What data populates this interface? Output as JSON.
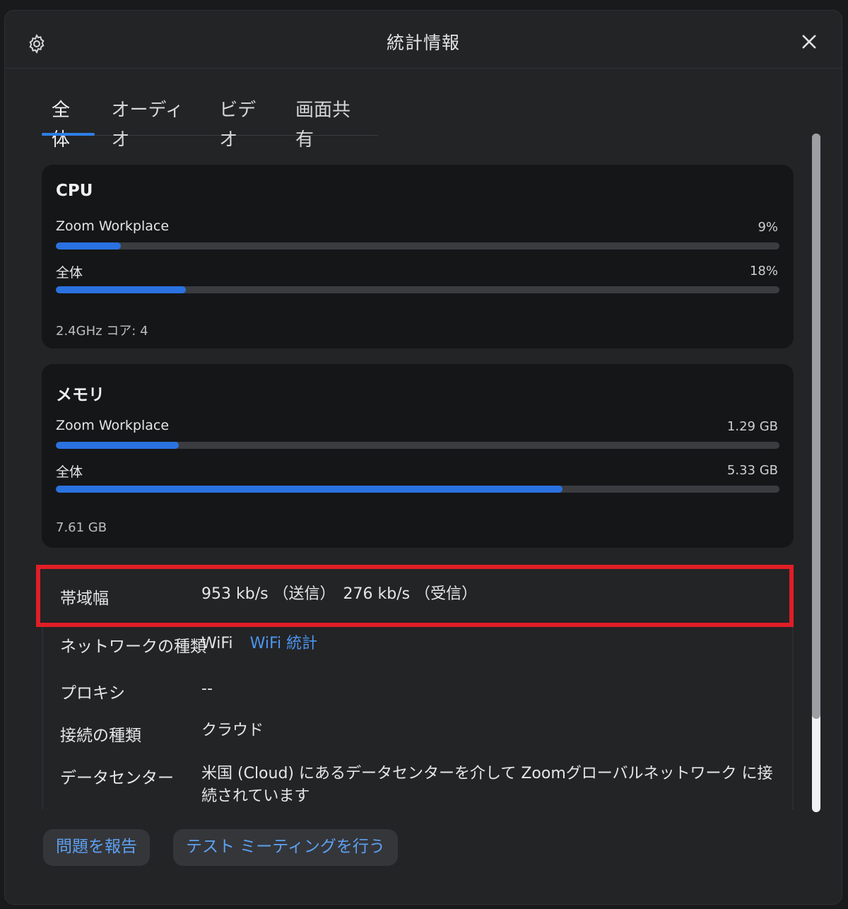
{
  "window": {
    "title": "統計情報"
  },
  "icons": {
    "settings": "gear-icon",
    "close": "close-icon"
  },
  "tabs": [
    {
      "label": "全体",
      "active": true
    },
    {
      "label": "オーディオ",
      "active": false
    },
    {
      "label": "ビデオ",
      "active": false
    },
    {
      "label": "画面共有",
      "active": false
    }
  ],
  "cpu": {
    "title": "CPU",
    "rows": [
      {
        "label": "Zoom Workplace",
        "value": "9%",
        "fraction": 0.09
      },
      {
        "label": "全体",
        "value": "18%",
        "fraction": 0.18
      }
    ],
    "footer": "2.4GHz コア: 4"
  },
  "memory": {
    "title": "メモリ",
    "rows": [
      {
        "label": "Zoom Workplace",
        "value": "1.29 GB",
        "fraction": 0.17
      },
      {
        "label": "全体",
        "value": "5.33 GB",
        "fraction": 0.7
      }
    ],
    "footer": "7.61 GB"
  },
  "info": {
    "bandwidth": {
      "label": "帯域幅",
      "value": "953 kb/s （送信）　276 kb/s （受信）"
    },
    "network": {
      "label": "ネットワークの種類",
      "value": "WiFi",
      "link": "WiFi 統計"
    },
    "proxy": {
      "label": "プロキシ",
      "value": "--"
    },
    "connection": {
      "label": "接続の種類",
      "value": "クラウド"
    },
    "datacenter": {
      "label": "データセンター",
      "value": "米国 (Cloud) にあるデータセンターを介して Zoomグローバルネットワーク に接続されています"
    }
  },
  "buttons": {
    "report": "問題を報告",
    "test_meeting": "テスト ミーティングを行う"
  },
  "colors": {
    "accent": "#2a72e0",
    "link": "#4c95ef",
    "highlight": "#e01e26"
  }
}
